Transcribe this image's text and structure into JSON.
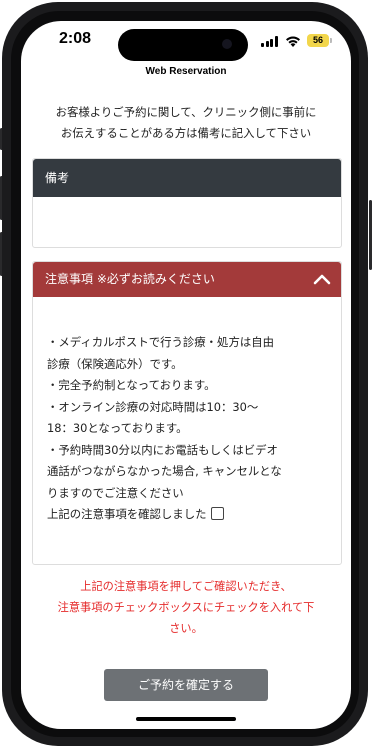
{
  "status_bar": {
    "time": "2:08",
    "battery": "56"
  },
  "header": {
    "title": "Web Reservation"
  },
  "intro": {
    "line1": "お客様よりご予約に関して、クリニック側に事前に",
    "line2": "お伝えすることがある方は備考に記入して下さい"
  },
  "remarks": {
    "label": "備考",
    "value": ""
  },
  "notes_panel": {
    "title": "注意事項 ※必ずお読みください",
    "lines": [
      "・メディカルポストで行う診療・処方は自由",
      "診療（保険適応外）です。",
      "・完全予約制となっております。",
      "・オンライン診療の対応時間は10：30〜",
      "18：30となっております。",
      "・予約時間30分以内にお電話もしくはビデオ",
      "通話がつながらなかった場合, キャンセルとな",
      "りますのでご注意ください"
    ],
    "confirm_label": "上記の注意事項を確認しました"
  },
  "warning": {
    "line1": "上記の注意事項を押してご確認いただき、",
    "line2": "注意事項のチェックボックスにチェックを入れて下",
    "line3": "さい。"
  },
  "submit": {
    "label": "ご予約を確定する"
  },
  "colors": {
    "dark_header": "#343a40",
    "red_header": "#a33a3a",
    "warning_text": "#e52b2b",
    "button": "#6d7175"
  }
}
